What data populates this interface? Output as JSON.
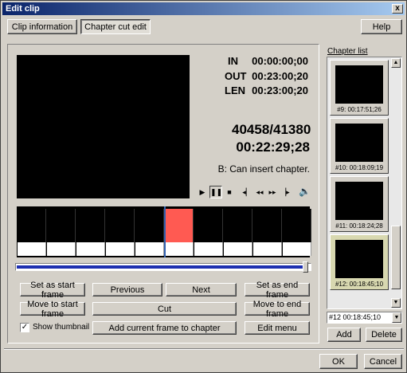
{
  "window": {
    "title": "Edit clip",
    "close_glyph": "x"
  },
  "tabs": [
    {
      "label": "Clip information",
      "selected": false
    },
    {
      "label": "Chapter cut edit",
      "selected": true
    }
  ],
  "help_label": "Help",
  "timecodes": {
    "in_label": "IN",
    "in_value": "00:00:00;00",
    "out_label": "OUT",
    "out_value": "00:23:00;20",
    "len_label": "LEN",
    "len_value": "00:23:00;20"
  },
  "frame_counter": "40458/41380",
  "current_time": "00:22:29;28",
  "status_text": "B: Can insert chapter.",
  "playback": {
    "play_icon": "play-icon",
    "pause_icon": "pause-icon",
    "stop_icon": "stop-icon",
    "prev_chapter_icon": "prev-chapter-icon",
    "rewind_icon": "rewind-icon",
    "forward_icon": "forward-icon",
    "next_chapter_icon": "next-chapter-icon",
    "volume_icon": "speaker-icon"
  },
  "timeline": {
    "highlight_color": "#ff5a52",
    "marker_color": "#3060b0"
  },
  "buttons": {
    "set_start": "Set as start frame",
    "previous": "Previous",
    "next": "Next",
    "set_end": "Set as end frame",
    "move_start": "Move to start frame",
    "cut": "Cut",
    "move_end": "Move to end frame",
    "add_current": "Add current frame to chapter",
    "edit_menu": "Edit menu",
    "add": "Add",
    "delete": "Delete",
    "ok": "OK",
    "cancel": "Cancel"
  },
  "show_thumbnail": {
    "label": "Show thumbnail",
    "checked": true
  },
  "chapter_list": {
    "title": "Chapter list",
    "items": [
      {
        "caption": "#9: 00:17:51;26",
        "selected": false
      },
      {
        "caption": "#10: 00:18:09;19",
        "selected": false
      },
      {
        "caption": "#11: 00:18:24;28",
        "selected": false
      },
      {
        "caption": "#12: 00:18:45;10",
        "selected": true
      }
    ],
    "dropdown_value": "#12  00:18:45;10"
  }
}
